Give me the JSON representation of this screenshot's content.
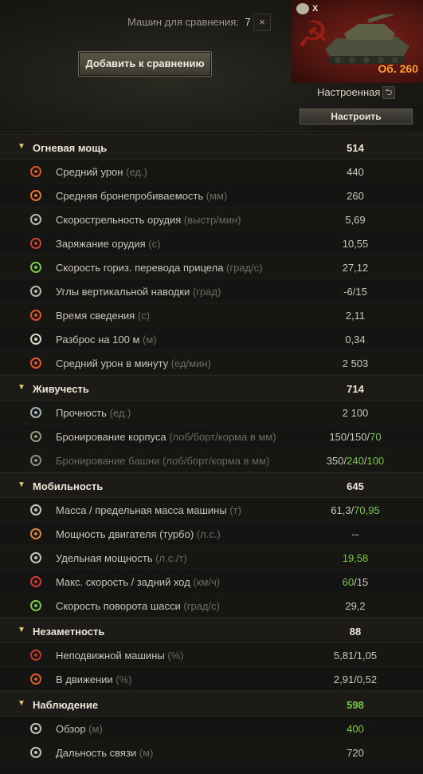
{
  "header": {
    "compare_label": "Машин для сравнения:",
    "compare_count": "7",
    "close": "×",
    "add_button": "Добавить к сравнению",
    "tank_tier": "X",
    "tank_name": "Об. 260",
    "setup_state": "Настроенная",
    "undo": "⮌",
    "setup_button": "Настроить"
  },
  "sections": [
    {
      "title": "Огневая мощь",
      "value": "514",
      "rows": [
        {
          "label": "Средний урон",
          "unit": "(ед.)",
          "value": "440",
          "icon": "damage-icon"
        },
        {
          "label": "Средняя бронепробиваемость",
          "unit": "(мм)",
          "value": "260",
          "icon": "penetration-icon"
        },
        {
          "label": "Скорострельность орудия",
          "unit": "(выстр/мин)",
          "value": "5,69",
          "icon": "rate-of-fire-icon"
        },
        {
          "label": "Заряжание орудия",
          "unit": "(с)",
          "value": "10,55",
          "icon": "reload-icon"
        },
        {
          "label": "Скорость гориз. перевода прицела",
          "unit": "(град/с)",
          "value": "27,12",
          "icon": "traverse-icon"
        },
        {
          "label": "Углы вертикальной наводки",
          "unit": "(град)",
          "value": "-6/15",
          "icon": "elevation-icon"
        },
        {
          "label": "Время сведения",
          "unit": "(с)",
          "value": "2,11",
          "icon": "aim-time-icon"
        },
        {
          "label": "Разброс на 100 м",
          "unit": "(м)",
          "value": "0,34",
          "icon": "dispersion-icon"
        },
        {
          "label": "Средний урон в минуту",
          "unit": "(ед/мин)",
          "value": "2 503",
          "icon": "dpm-icon"
        }
      ]
    },
    {
      "title": "Живучесть",
      "value": "714",
      "rows": [
        {
          "label": "Прочность",
          "unit": "(ед.)",
          "value": "2 100",
          "icon": "hitpoints-icon"
        },
        {
          "label": "Бронирование корпуса",
          "unit": "(лоб/борт/корма в мм)",
          "value": "150/150/70",
          "icon": "hull-armor-icon"
        },
        {
          "label": "Бронирование башни",
          "unit": "(лоб/борт/корма в мм)",
          "value": "350/240/100",
          "icon": "turret-armor-icon",
          "dim": true
        }
      ]
    },
    {
      "title": "Мобильность",
      "value": "645",
      "rows": [
        {
          "label": "Масса / предельная масса машины",
          "unit": "(т)",
          "value": "61,3/70,95",
          "icon": "weight-icon"
        },
        {
          "label": "Мощность двигателя (турбо)",
          "unit": "(л.с.)",
          "value": "--",
          "icon": "engine-icon"
        },
        {
          "label": "Удельная мощность",
          "unit": "(л.с./т)",
          "value": "19,58",
          "icon": "power-ratio-icon"
        },
        {
          "label": "Макс. скорость / задний ход",
          "unit": "(км/ч)",
          "value": "60/15",
          "icon": "speed-icon"
        },
        {
          "label": "Скорость поворота шасси",
          "unit": "(град/с)",
          "value": "29,2",
          "icon": "hull-traverse-icon"
        }
      ]
    },
    {
      "title": "Незаметность",
      "value": "88",
      "rows": [
        {
          "label": "Неподвижной машины",
          "unit": "(%)",
          "value": "5,81/1,05",
          "icon": "camo-stationary-icon"
        },
        {
          "label": "В движении",
          "unit": "(%)",
          "value": "2,91/0,52",
          "icon": "camo-moving-icon"
        }
      ]
    },
    {
      "title": "Наблюдение",
      "value": "598",
      "rows": [
        {
          "label": "Обзор",
          "unit": "(м)",
          "value": "400",
          "icon": "view-range-icon"
        },
        {
          "label": "Дальность связи",
          "unit": "(м)",
          "value": "720",
          "icon": "radio-range-icon"
        }
      ]
    }
  ],
  "colors": {
    "accent": "#e8c76a",
    "highlight": "#7ec849",
    "tank_name": "#ff9c2c"
  }
}
